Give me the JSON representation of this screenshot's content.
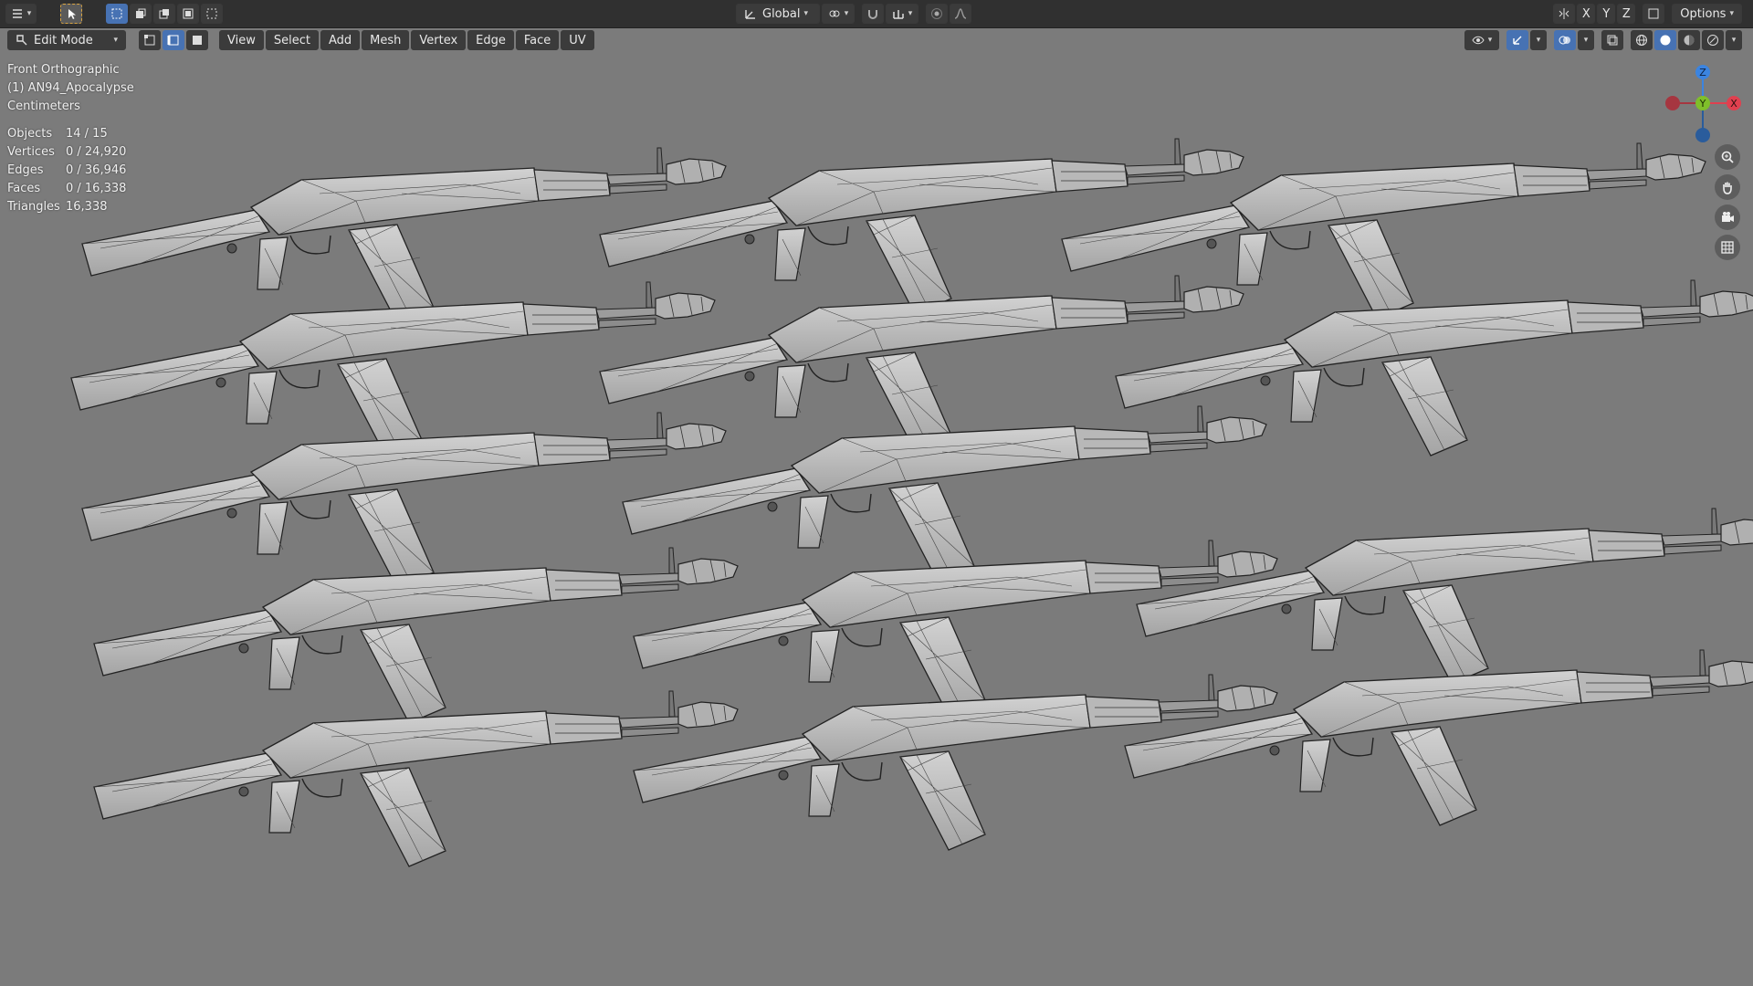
{
  "header": {
    "transform_orientation": "Global",
    "options_label": "Options",
    "axis_x": "X",
    "axis_y": "Y",
    "axis_z": "Z"
  },
  "toolbar": {
    "mode": "Edit Mode",
    "menus": [
      "View",
      "Select",
      "Add",
      "Mesh",
      "Vertex",
      "Edge",
      "Face",
      "UV"
    ]
  },
  "viewport": {
    "view_name": "Front Orthographic",
    "object_name": "(1) AN94_Apocalypse",
    "units": "Centimeters"
  },
  "stats": [
    {
      "label": "Objects",
      "value": "14 / 15"
    },
    {
      "label": "Vertices",
      "value": "0 / 24,920"
    },
    {
      "label": "Edges",
      "value": "0 / 36,946"
    },
    {
      "label": "Faces",
      "value": "0 / 16,338"
    },
    {
      "label": "Triangles",
      "value": "16,338"
    }
  ],
  "gizmo": {
    "x_label": "X",
    "y_label": "Y",
    "z_label": "Z"
  },
  "colors": {
    "background": "#7b7b7b",
    "header": "#303030",
    "accent": "#4772b3",
    "axis_x": "#e0404f",
    "axis_y": "#7fbf2a",
    "axis_z": "#3b84e0"
  },
  "icons": [
    "editor-type-icon",
    "select-tool-icon",
    "box-select-icon",
    "select-new-icon",
    "select-extend-icon",
    "select-subtract-icon",
    "select-invert-icon",
    "orientation-icon",
    "pivot-icon",
    "snap-icon",
    "proportional-icon",
    "overlay-icon",
    "gizmo-icon",
    "xray-icon",
    "wireframe-shading-icon",
    "solid-shading-icon",
    "material-shading-icon",
    "rendered-shading-icon",
    "zoom-icon",
    "pan-hand-icon",
    "camera-icon",
    "grid-icon",
    "vertex-mode-icon",
    "edge-mode-icon",
    "face-mode-icon"
  ]
}
